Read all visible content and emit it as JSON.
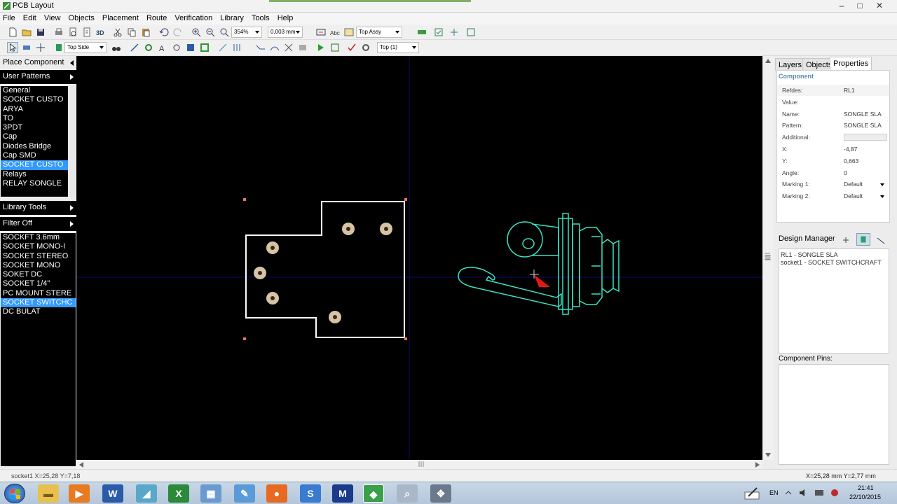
{
  "window": {
    "title": "PCB Layout",
    "minimize": "‒",
    "maximize": "□",
    "close": "✕"
  },
  "menu": [
    "File",
    "Edit",
    "View",
    "Objects",
    "Placement",
    "Route",
    "Verification",
    "Library",
    "Tools",
    "Help"
  ],
  "toolbar1": {
    "zoom": "354%",
    "grid": "0,003 mm",
    "layer_view": "Top Assy"
  },
  "toolbar2": {
    "side": "Top Side",
    "layer": "Top (1)"
  },
  "left_panel": {
    "place_component": "Place Component",
    "user_patterns": "User Patterns",
    "pattern_groups": [
      "General",
      "SOCKET CUSTO",
      "ARYA",
      "TO",
      "3PDT",
      "Cap",
      "Diodes Bridge",
      "Cap SMD",
      "SOCKET CUSTO",
      "Relays",
      "RELAY SONGLE"
    ],
    "library_tools": "Library Tools",
    "filter": "Filter Off",
    "patterns": [
      "SOCKFT 3.6mm",
      "SOCKET MONO-I",
      "SOCKET STEREO",
      "SOCKET MONO",
      "SOKET DC",
      "SOCKET 1/4\"",
      "PC MOUNT STERE",
      "SOCKET SWITCHC",
      "DC BULAT"
    ]
  },
  "right_panel": {
    "tabs": [
      "Layers",
      "Objects",
      "Properties"
    ],
    "section": "Component",
    "properties": [
      {
        "key": "Refdes:",
        "value": "RL1"
      },
      {
        "key": "Value:",
        "value": ""
      },
      {
        "key": "Name:",
        "value": "SONGLE SLA"
      },
      {
        "key": "Pattern:",
        "value": "SONGLE SLA"
      },
      {
        "key": "Additional:",
        "value": ""
      },
      {
        "key": "X:",
        "value": "-4,87"
      },
      {
        "key": "Y:",
        "value": "0,663"
      },
      {
        "key": "Angle:",
        "value": "0"
      },
      {
        "key": "Marking 1:",
        "value": "Default"
      },
      {
        "key": "Marking 2:",
        "value": "Default"
      }
    ],
    "design_manager": "Design Manager",
    "design_items": [
      "RL1 - SONGLE SLA",
      "socket1 - SOCKET SWITCHCRAFT"
    ],
    "component_pins": "Component Pins:"
  },
  "status": {
    "left": "socket1  X=25,28  Y=7,18",
    "right": "X=25,28 mm   Y=2,77 mm"
  },
  "taskbar": {
    "lang": "EN",
    "time": "21:41",
    "date": "22/10/2015"
  },
  "colors": {
    "canvas": "#000000",
    "outline": "#ffffff",
    "pad": "#d6c3a5",
    "component": "#38e3c3",
    "selection": "#3399ff",
    "crosshair": "#000080"
  }
}
